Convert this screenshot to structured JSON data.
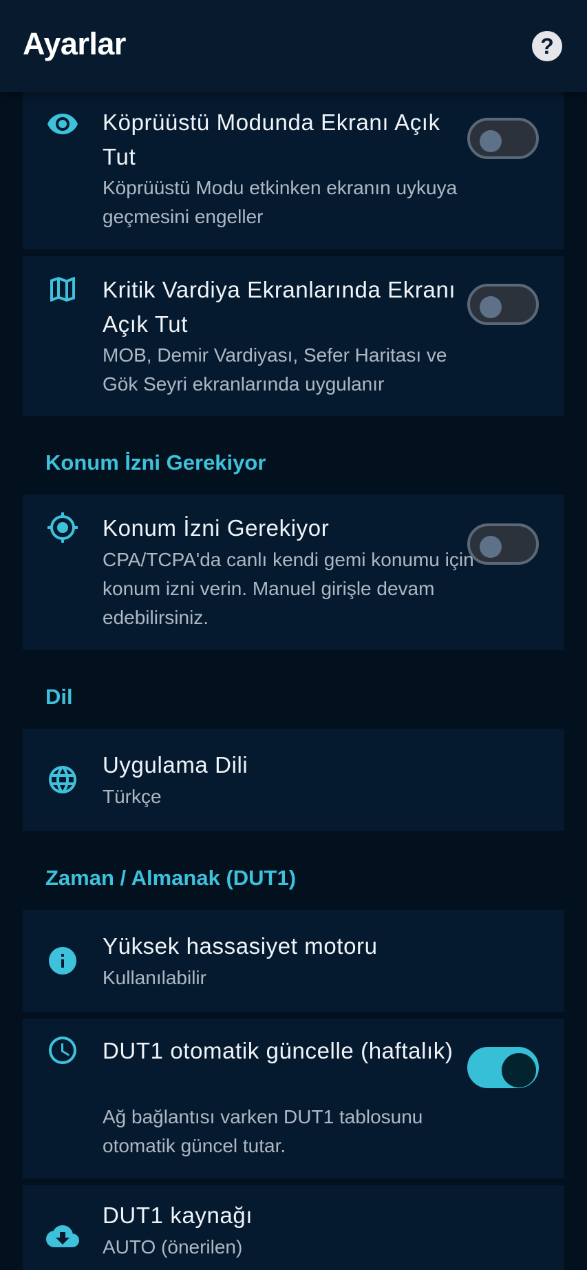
{
  "appbar": {
    "title": "Ayarlar",
    "help_icon_glyph": "?"
  },
  "colors": {
    "accent": "#3ec1db",
    "background": "#03111f",
    "card": "#061a2f",
    "toggle_on": "#36bfd6"
  },
  "settings": {
    "keep_screen_bridge": {
      "icon": "eye-icon",
      "title": "Köprüüstü Modunda Ekranı Açık Tut",
      "subtitle": "Köprüüstü Modu etkinken ekranın uykuya geçmesini engeller",
      "enabled": false
    },
    "keep_screen_critical": {
      "icon": "map-icon",
      "title": "Kritik Vardiya Ekranlarında Ekranı Açık Tut",
      "subtitle": "MOB, Demir Vardiyası, Sefer Haritası ve Gök Seyri ekranlarında uygulanır",
      "enabled": false
    }
  },
  "location_section": {
    "header": "Konum İzni Gerekiyor",
    "item": {
      "icon": "location-crosshair-icon",
      "title": "Konum İzni Gerekiyor",
      "subtitle": "CPA/TCPA'da canlı kendi gemi konumu için konum izni verin. Manuel girişle devam edebilirsiniz.",
      "enabled": false
    }
  },
  "language_section": {
    "header": "Dil",
    "item": {
      "icon": "globe-icon",
      "title": "Uygulama Dili",
      "value": "Türkçe"
    }
  },
  "time_section": {
    "header": "Zaman / Almanak (DUT1)",
    "engine": {
      "icon": "info-icon",
      "title": "Yüksek hassasiyet motoru",
      "value": "Kullanılabilir"
    },
    "auto_update": {
      "icon": "clock-icon",
      "title": "DUT1 otomatik güncelle (haftalık)",
      "subtitle": "Ağ bağlantısı varken DUT1 tablosunu otomatik güncel tutar.",
      "enabled": true
    },
    "source": {
      "icon": "cloud-download-icon",
      "title": "DUT1 kaynağı",
      "value": "AUTO (önerilen)"
    }
  }
}
